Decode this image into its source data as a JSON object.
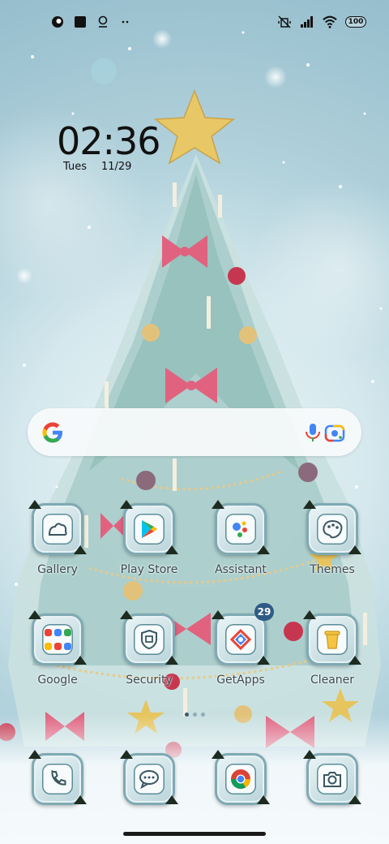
{
  "status_bar": {
    "left_icons": [
      "app-notification-icon",
      "square-notification-icon",
      "location-pin-icon",
      "more-notifications-icon"
    ],
    "right_icons": [
      "vibrate-off-icon",
      "signal-icon",
      "wifi-icon"
    ],
    "battery": "100"
  },
  "clock": {
    "time": "02:36",
    "day": "Tues",
    "date": "11/29"
  },
  "search": {
    "icons": [
      "google-logo-icon",
      "microphone-icon",
      "google-lens-icon"
    ]
  },
  "apps": {
    "row1": [
      {
        "label": "Gallery",
        "icon": "gallery-icon"
      },
      {
        "label": "Play Store",
        "icon": "play-store-icon"
      },
      {
        "label": "Assistant",
        "icon": "assistant-icon"
      },
      {
        "label": "Themes",
        "icon": "themes-icon"
      }
    ],
    "row2": [
      {
        "label": "Google",
        "icon": "google-folder-icon"
      },
      {
        "label": "Security",
        "icon": "security-icon"
      },
      {
        "label": "GetApps",
        "icon": "getapps-icon",
        "badge": "29"
      },
      {
        "label": "Cleaner",
        "icon": "cleaner-icon"
      }
    ],
    "dock": [
      {
        "label": "",
        "icon": "phone-icon"
      },
      {
        "label": "",
        "icon": "messages-icon"
      },
      {
        "label": "",
        "icon": "chrome-icon"
      },
      {
        "label": "",
        "icon": "camera-icon"
      }
    ]
  },
  "colors": {
    "badge": "#2e5b85",
    "icon_frame": "#7fa9b3",
    "label": "#3b4a50"
  }
}
